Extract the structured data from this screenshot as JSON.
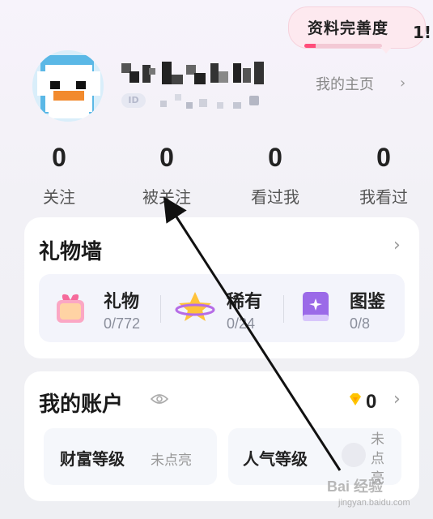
{
  "profile": {
    "completeness_label": "资料完善度",
    "completeness_value": "1!",
    "completeness_fraction": 0.15,
    "id_badge": "ID",
    "home_link": "我的主页",
    "home_chevron": "›"
  },
  "stats": [
    {
      "value": "0",
      "label": "关注"
    },
    {
      "value": "0",
      "label": "被关注"
    },
    {
      "value": "0",
      "label": "看过我"
    },
    {
      "value": "0",
      "label": "我看过"
    }
  ],
  "gift_wall": {
    "title": "礼物墙",
    "chevron": "›",
    "items": [
      {
        "name": "礼物",
        "count": "0/772",
        "icon": "gift-box-icon"
      },
      {
        "name": "稀有",
        "count": "0/24",
        "icon": "star-planet-icon"
      },
      {
        "name": "图鉴",
        "count": "0/8",
        "icon": "book-icon"
      }
    ]
  },
  "account": {
    "title": "我的账户",
    "coin_value": "0",
    "chevron": "›",
    "levels": [
      {
        "title": "财富等级",
        "status": "未点亮"
      },
      {
        "title": "人气等级",
        "status": "未点亮"
      }
    ]
  },
  "watermark": {
    "brand": "Bai 经验",
    "url": "jingyan.baidu.com"
  }
}
